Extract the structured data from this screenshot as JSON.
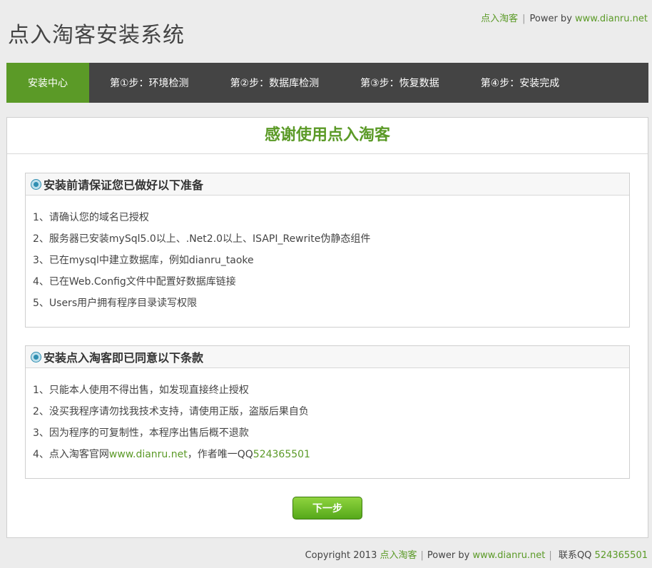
{
  "header": {
    "links": [
      {
        "text": "点入淘客"
      },
      {
        "prefix": "Power by",
        "text": "www.dianru.net"
      }
    ],
    "title": "点入淘客安装系统"
  },
  "nav": {
    "active": "安装中心",
    "steps": [
      "第①步：环境检测",
      "第②步：数据库检测",
      "第③步：恢复数据",
      "第④步：安装完成"
    ]
  },
  "main": {
    "title": "感谢使用点入淘客",
    "sections": [
      {
        "heading": "安装前请保证您已做好以下准备",
        "items": [
          "1、请确认您的域名已授权",
          "2、服务器已安装mySql5.0以上、.Net2.0以上、ISAPI_Rewrite伪静态组件",
          "3、已在mysql中建立数据库，例如dianru_taoke",
          "4、已在Web.Config文件中配置好数据库链接",
          "5、Users用户拥有程序目录读写权限"
        ]
      },
      {
        "heading": "安装点入淘客即已同意以下条款",
        "items": [
          "1、只能本人使用不得出售，如发现直接终止授权",
          "2、没买我程序请勿找我技术支持，请使用正版，盗版后果自负",
          "3、因为程序的可复制性，本程序出售后概不退款"
        ],
        "item4": {
          "prefix": "4、点入淘客官网",
          "site": "www.dianru.net",
          "middle": "，作者唯一QQ",
          "qq": "524365501"
        }
      }
    ],
    "next_label": "下一步"
  },
  "footer": {
    "copyright": "Copyright 2013",
    "brand": "点入淘客",
    "power_prefix": "Power by",
    "power_link": "www.dianru.net",
    "qq_label": "联系QQ",
    "qq": "524365501"
  },
  "colors": {
    "accent": "#5b9a27",
    "nav_bg": "#444444",
    "page_bg": "#ececec"
  }
}
